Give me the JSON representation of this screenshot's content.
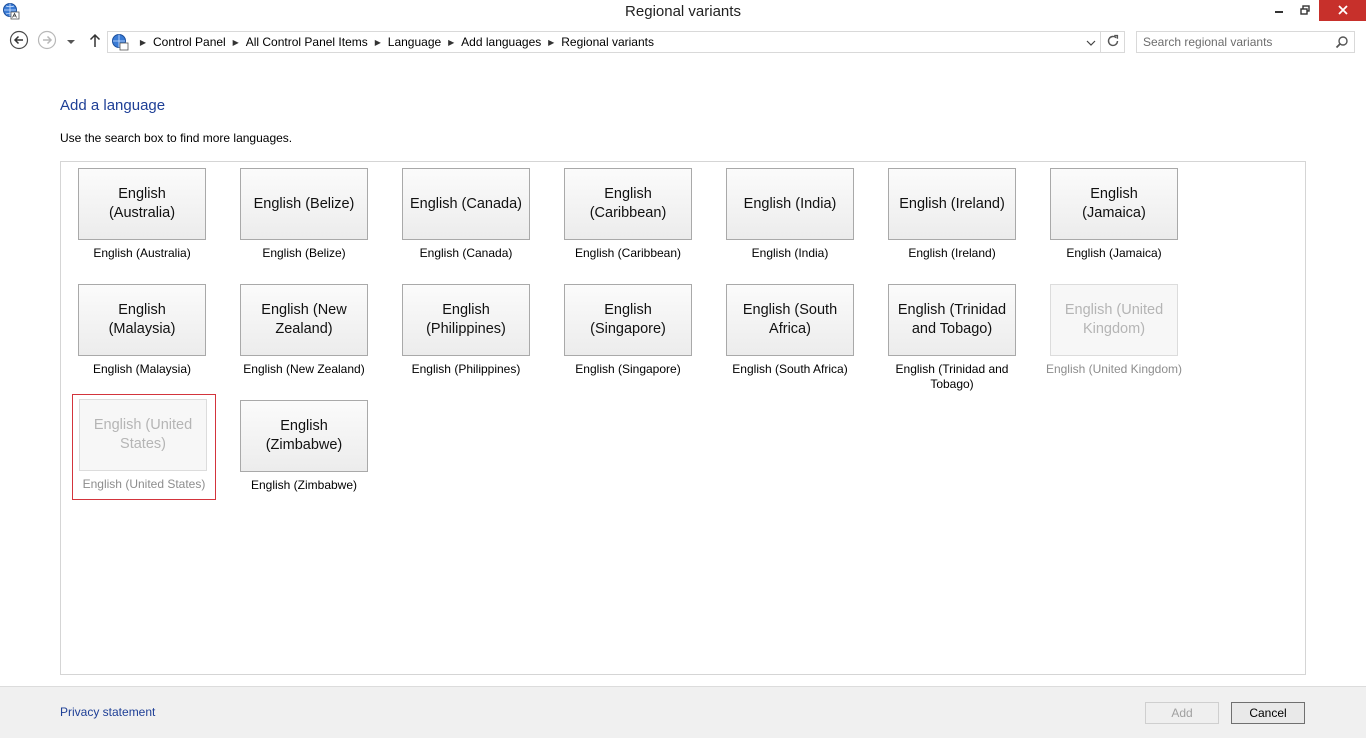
{
  "window": {
    "title": "Regional variants",
    "accent_close": "#c7302b"
  },
  "address_bar": {
    "breadcrumbs": [
      "Control Panel",
      "All Control Panel Items",
      "Language",
      "Add languages",
      "Regional variants"
    ]
  },
  "search": {
    "placeholder": "Search regional variants"
  },
  "content": {
    "heading": "Add a language",
    "instruction": "Use the search box to find more languages."
  },
  "languages": [
    {
      "tile": "English (Australia)",
      "caption": "English (Australia)",
      "disabled": false
    },
    {
      "tile": "English (Belize)",
      "caption": "English (Belize)",
      "disabled": false
    },
    {
      "tile": "English (Canada)",
      "caption": "English (Canada)",
      "disabled": false
    },
    {
      "tile": "English (Caribbean)",
      "caption": "English (Caribbean)",
      "disabled": false
    },
    {
      "tile": "English (India)",
      "caption": "English (India)",
      "disabled": false
    },
    {
      "tile": "English (Ireland)",
      "caption": "English (Ireland)",
      "disabled": false
    },
    {
      "tile": "English (Jamaica)",
      "caption": "English (Jamaica)",
      "disabled": false
    },
    {
      "tile": "English (Malaysia)",
      "caption": "English (Malaysia)",
      "disabled": false
    },
    {
      "tile": "English (New Zealand)",
      "caption": "English (New Zealand)",
      "disabled": false
    },
    {
      "tile": "English (Philippines)",
      "caption": "English (Philippines)",
      "disabled": false
    },
    {
      "tile": "English (Singapore)",
      "caption": "English (Singapore)",
      "disabled": false
    },
    {
      "tile": "English (South Africa)",
      "caption": "English (South Africa)",
      "disabled": false
    },
    {
      "tile": "English (Trinidad and Tobago)",
      "caption": "English (Trinidad and Tobago)",
      "disabled": false
    },
    {
      "tile": "English (United Kingdom)",
      "caption": "English (United Kingdom)",
      "disabled": true
    },
    {
      "tile": "English (United States)",
      "caption": "English (United States)",
      "disabled": true,
      "selected": true
    },
    {
      "tile": "English (Zimbabwe)",
      "caption": "English (Zimbabwe)",
      "disabled": false
    }
  ],
  "footer": {
    "privacy_link": "Privacy statement",
    "add_label": "Add",
    "cancel_label": "Cancel"
  },
  "icons": {
    "app": "globe-language-icon",
    "back": "back-arrow-icon",
    "forward": "forward-arrow-icon",
    "recent": "chevron-down-icon",
    "up": "up-arrow-icon",
    "refresh": "refresh-icon",
    "search": "search-icon"
  }
}
